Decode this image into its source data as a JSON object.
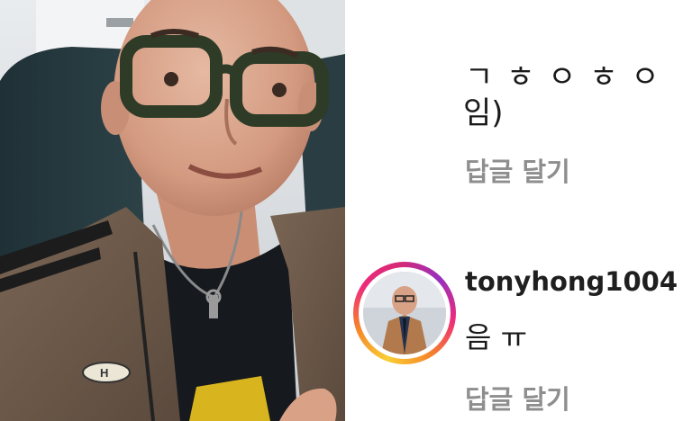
{
  "photo": {
    "icon": "selfie-photo"
  },
  "comments": {
    "previous": {
      "cut_off_text": "ㄱ ㅎ ㅇ ㅎ ㅇ",
      "text": "임)",
      "reply_label": "답글 달기"
    },
    "main": {
      "username": "tonyhong1004",
      "text": "음 ㅠ",
      "reply_label": "답글 달기",
      "avatar_icon": "profile-avatar"
    }
  },
  "colors": {
    "text": "#1a1a1a",
    "secondary_text": "#8e8e8e",
    "story_ring": [
      "#f9ce34",
      "#ee2a7b",
      "#962fbf"
    ]
  }
}
